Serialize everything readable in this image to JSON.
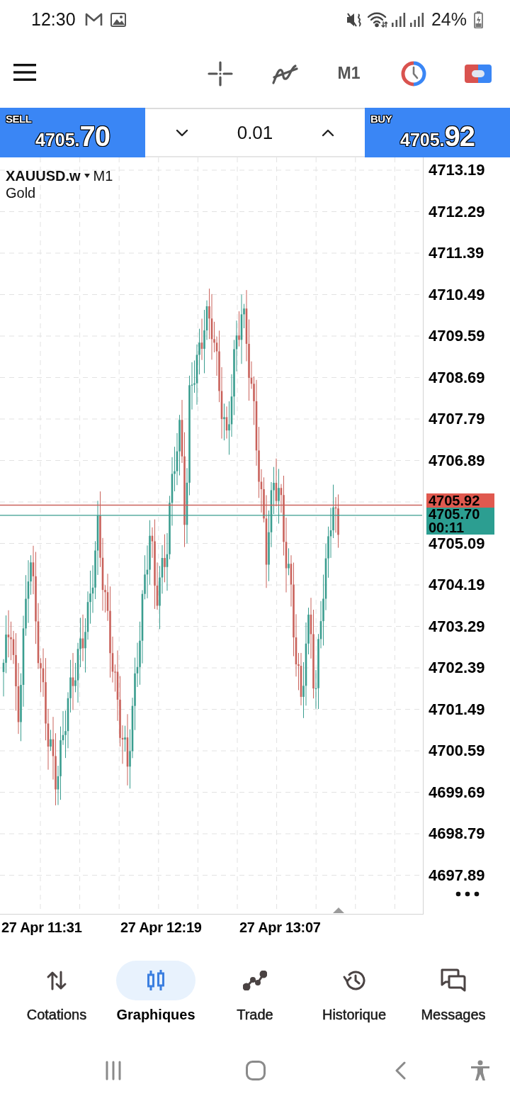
{
  "status_bar": {
    "time": "12:30",
    "battery": "24%"
  },
  "toolbar": {
    "timeframe": "M1"
  },
  "trade_panel": {
    "sell": {
      "label": "SELL",
      "price_whole": "4705.",
      "price_pips": "70"
    },
    "volume": "0.01",
    "buy": {
      "label": "BUY",
      "price_whole": "4705.",
      "price_pips": "92"
    }
  },
  "chart": {
    "symbol": "XAUUSD.w",
    "timeframe": "M1",
    "description": "Gold",
    "price_labels_upper": [
      "4713.19",
      "4712.29",
      "4711.39",
      "4710.49",
      "4709.59",
      "4708.69",
      "4707.79",
      "4706.89"
    ],
    "ask_tag": "4705.92",
    "bid_tag": "4705.70",
    "bar_countdown": "00:11",
    "price_labels_lower": [
      "4705.09",
      "4704.19",
      "4703.29",
      "4702.39",
      "4701.49",
      "4700.59",
      "4699.69",
      "4698.79",
      "4697.89"
    ],
    "time_labels": [
      "27 Apr 11:31",
      "27 Apr 12:19",
      "27 Apr 13:07"
    ]
  },
  "bottom_nav": [
    {
      "label": "Cotations",
      "selected": false
    },
    {
      "label": "Graphiques",
      "selected": true
    },
    {
      "label": "Trade",
      "selected": false
    },
    {
      "label": "Historique",
      "selected": false
    },
    {
      "label": "Messages",
      "selected": false
    }
  ]
}
